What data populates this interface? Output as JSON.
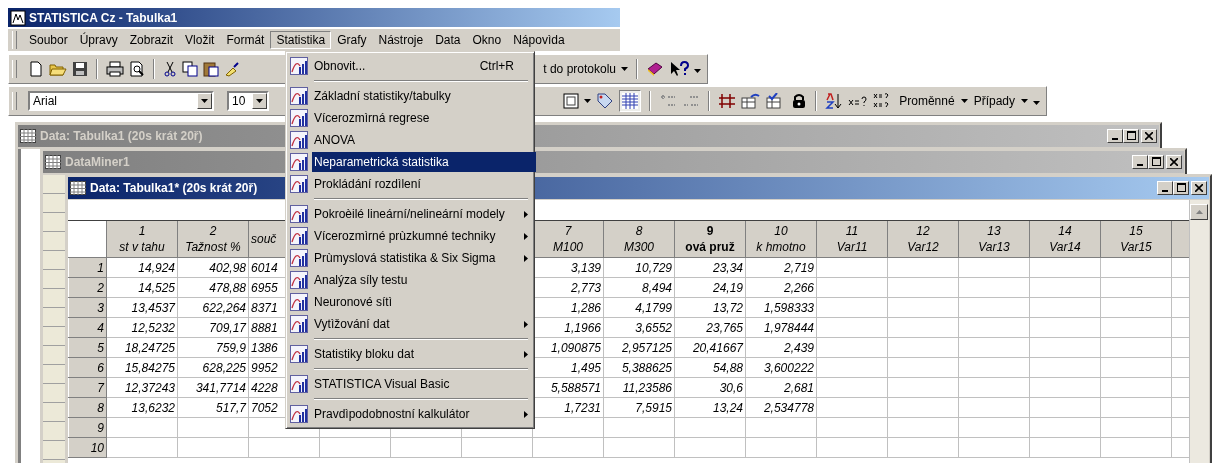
{
  "window": {
    "title": "STATISTICA Cz - Tabulka1"
  },
  "menu_bar": [
    {
      "label": "Soubor",
      "selected": false
    },
    {
      "label": "Úpravy",
      "selected": false
    },
    {
      "label": "Zobrazit",
      "selected": false
    },
    {
      "label": "Vložit",
      "selected": false
    },
    {
      "label": "Formát",
      "selected": false
    },
    {
      "label": "Statistika",
      "selected": true
    },
    {
      "label": "Grafy",
      "selected": false
    },
    {
      "label": "Nástroje",
      "selected": false
    },
    {
      "label": "Data",
      "selected": false
    },
    {
      "label": "Okno",
      "selected": false
    },
    {
      "label": "Nápovìda",
      "selected": false
    }
  ],
  "toolbar": {
    "output_label": "t do protokolu",
    "font": "Arial",
    "font_size": "10",
    "variables_label": "Proměnné",
    "cases_label": "Případy"
  },
  "documents": [
    {
      "title": "Data: Tabulka1 (20s krát 20ř)",
      "active": false
    },
    {
      "title": "DataMiner1",
      "active": false
    },
    {
      "title": "Data: Tabulka1* (20s krát 20ř)",
      "active": true
    }
  ],
  "table": {
    "columns": [
      {
        "number": "1",
        "name": "st v tahu",
        "bold": false,
        "kind": "full"
      },
      {
        "number": "2",
        "name": "Tažnost %",
        "bold": false,
        "kind": "full"
      },
      {
        "name": "souč",
        "bold": false,
        "kind": "cut"
      },
      {
        "number": "7",
        "name": "M100",
        "bold": false,
        "kind": "full"
      },
      {
        "number": "8",
        "name": "M300",
        "bold": false,
        "kind": "full"
      },
      {
        "number": "9",
        "name": "ová pruž",
        "bold": true,
        "kind": "full"
      },
      {
        "number": "10",
        "name": "k hmotno",
        "bold": false,
        "kind": "full"
      },
      {
        "number": "11",
        "name": "Var11",
        "bold": false,
        "kind": "full"
      },
      {
        "number": "12",
        "name": "Var12",
        "bold": false,
        "kind": "full"
      },
      {
        "number": "13",
        "name": "Var13",
        "bold": false,
        "kind": "full"
      },
      {
        "number": "14",
        "name": "Var14",
        "bold": false,
        "kind": "full"
      },
      {
        "number": "15",
        "name": "Var15",
        "bold": false,
        "kind": "full"
      }
    ],
    "rows": [
      {
        "label": "1",
        "cells": [
          "14,924",
          "402,98",
          "6014",
          "3,139",
          "10,729",
          "23,34",
          "2,719"
        ]
      },
      {
        "label": "2",
        "cells": [
          "14,525",
          "478,88",
          "6955",
          "2,773",
          "8,494",
          "24,19",
          "2,266"
        ]
      },
      {
        "label": "3",
        "cells": [
          "13,4537",
          "622,264",
          "8371",
          "1,286",
          "4,1799",
          "13,72",
          "1,598333"
        ]
      },
      {
        "label": "4",
        "cells": [
          "12,5232",
          "709,17",
          "8881",
          "1,1966",
          "3,6552",
          "23,765",
          "1,978444"
        ]
      },
      {
        "label": "5",
        "cells": [
          "18,24725",
          "759,9",
          "1386",
          "1,090875",
          "2,957125",
          "20,41667",
          "2,439"
        ]
      },
      {
        "label": "6",
        "cells": [
          "15,84275",
          "628,225",
          "9952",
          "1,495",
          "5,388625",
          "54,88",
          "3,600222"
        ]
      },
      {
        "label": "7",
        "cells": [
          "12,37243",
          "341,7714",
          "4228",
          "5,588571",
          "11,23586",
          "30,6",
          "2,681"
        ]
      },
      {
        "label": "8",
        "cells": [
          "13,6232",
          "517,7",
          "7052",
          "1,7231",
          "7,5915",
          "13,24",
          "2,534778"
        ]
      },
      {
        "label": "9",
        "cells": []
      },
      {
        "label": "10",
        "cells": []
      }
    ]
  },
  "statistics_menu": [
    {
      "kind": "item",
      "label": "Obnovit...",
      "shortcut": "Ctrl+R",
      "submenu": false,
      "selected": false
    },
    {
      "kind": "separator"
    },
    {
      "kind": "item",
      "label": "Základní statistiky/tabulky",
      "submenu": false,
      "selected": false
    },
    {
      "kind": "item",
      "label": "Vícerozmìrná regrese",
      "submenu": false,
      "selected": false
    },
    {
      "kind": "item",
      "label": "ANOVA",
      "submenu": false,
      "selected": false
    },
    {
      "kind": "item",
      "label": "Neparametrická statistika",
      "submenu": false,
      "selected": true
    },
    {
      "kind": "item",
      "label": "Prokládání rozdìlení",
      "submenu": false,
      "selected": false
    },
    {
      "kind": "separator"
    },
    {
      "kind": "item",
      "label": "Pokroèilé lineární/nelineární modely",
      "submenu": true,
      "selected": false
    },
    {
      "kind": "item",
      "label": "Vícerozmìrné prùzkumné techniky",
      "submenu": true,
      "selected": false
    },
    {
      "kind": "item",
      "label": "Prùmyslová statistika & Six Sigma",
      "submenu": true,
      "selected": false
    },
    {
      "kind": "item",
      "label": "Analýza síly testu",
      "submenu": false,
      "selected": false
    },
    {
      "kind": "item",
      "label": "Neuronové sítì",
      "submenu": false,
      "selected": false
    },
    {
      "kind": "item",
      "label": "Vytìžování dat",
      "submenu": true,
      "selected": false
    },
    {
      "kind": "separator"
    },
    {
      "kind": "item",
      "label": "Statistiky bloku dat",
      "submenu": true,
      "selected": false
    },
    {
      "kind": "separator"
    },
    {
      "kind": "item",
      "label": "STATISTICA Visual Basic",
      "submenu": false,
      "selected": false
    },
    {
      "kind": "separator"
    },
    {
      "kind": "item",
      "label": "Pravdìpodobnostní kalkulátor",
      "submenu": true,
      "selected": false
    }
  ]
}
